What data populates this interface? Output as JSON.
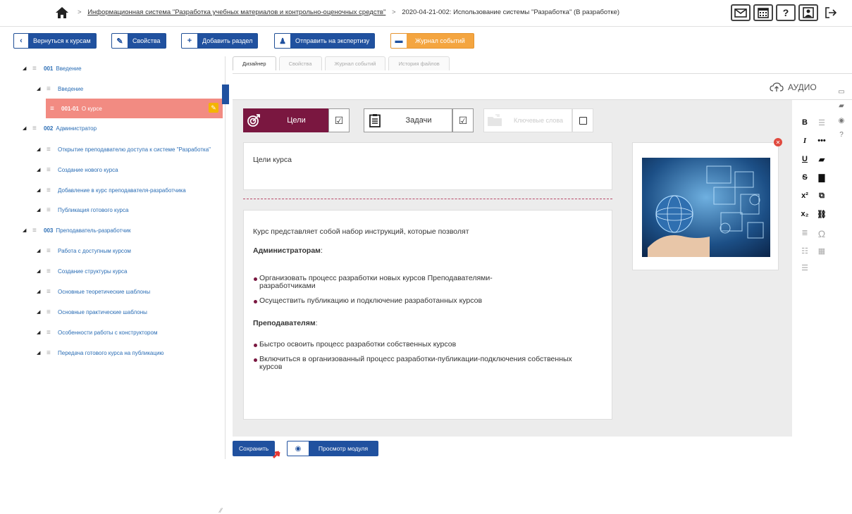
{
  "breadcrumb": {
    "system": "Информационная система \"Разработка учебных материалов и контрольно-оценочных средств\"",
    "course": "2020-04-21-002: Использование системы \"Разработка\" (В разработке)"
  },
  "toolbar": {
    "back": "Вернуться к курсам",
    "props": "Свойства",
    "add_section": "Добавить раздел",
    "send_expert": "Отправить на экспертизу",
    "log": "Журнал событий"
  },
  "tree": [
    {
      "num": "001",
      "label": "Введение"
    },
    {
      "num": "",
      "label": "Введение"
    },
    {
      "num": "001-01",
      "label": "О курсе"
    },
    {
      "num": "002",
      "label": "Администратор"
    },
    {
      "num": "",
      "label": "Открытие преподавателю доступа к системе \"Разработка\""
    },
    {
      "num": "",
      "label": "Создание нового курса"
    },
    {
      "num": "",
      "label": "Добавление в курс преподавателя-разработчика"
    },
    {
      "num": "",
      "label": "Публикация готового курса"
    },
    {
      "num": "003",
      "label": "Преподаватель-разработчик"
    },
    {
      "num": "",
      "label": "Работа с доступным курсом"
    },
    {
      "num": "",
      "label": "Создание структуры курса"
    },
    {
      "num": "",
      "label": "Основные теоретические шаблоны"
    },
    {
      "num": "",
      "label": "Основные практические шаблоны"
    },
    {
      "num": "",
      "label": "Особенности работы с конструктором"
    },
    {
      "num": "",
      "label": "Передача готового курса на публикацию"
    }
  ],
  "tabs": [
    "Дизайнер",
    "Свойства",
    "Журнал событий",
    "История файлов"
  ],
  "audio_label": "АУДИО",
  "goals": {
    "cel": "Цели",
    "tasks": "Задачи",
    "keys": "Ключевые слова",
    "check": "☑"
  },
  "card1_text": "Цели курса",
  "content": {
    "intro": "Курс представляет собой набор инструкций, которые позволят",
    "admins_heading": "Администраторам",
    "admins": [
      "Организовать процесс разработки новых курсов Преподавателями-разработчиками",
      "Осуществить публикацию и подключение разработанных курсов"
    ],
    "teachers_heading": "Преподавателям",
    "teachers": [
      "Быстро освоить процесс разработки собственных курсов",
      "Включиться в организованный процесс разработки-публикации-подключения собственных курсов"
    ],
    "colon": ":"
  },
  "format": {
    "bold": "B",
    "italic": "I",
    "underline": "U",
    "strike": "S",
    "sup": "x²",
    "sub": "x₂",
    "omega": "Ω",
    "more": "•••"
  },
  "bottom": {
    "save": "Сохранить",
    "preview": "Просмотр модуля"
  },
  "colors": {
    "primary": "#20519f",
    "accent": "#7a1740",
    "orange": "#f4a540",
    "selected": "#f28b82"
  }
}
